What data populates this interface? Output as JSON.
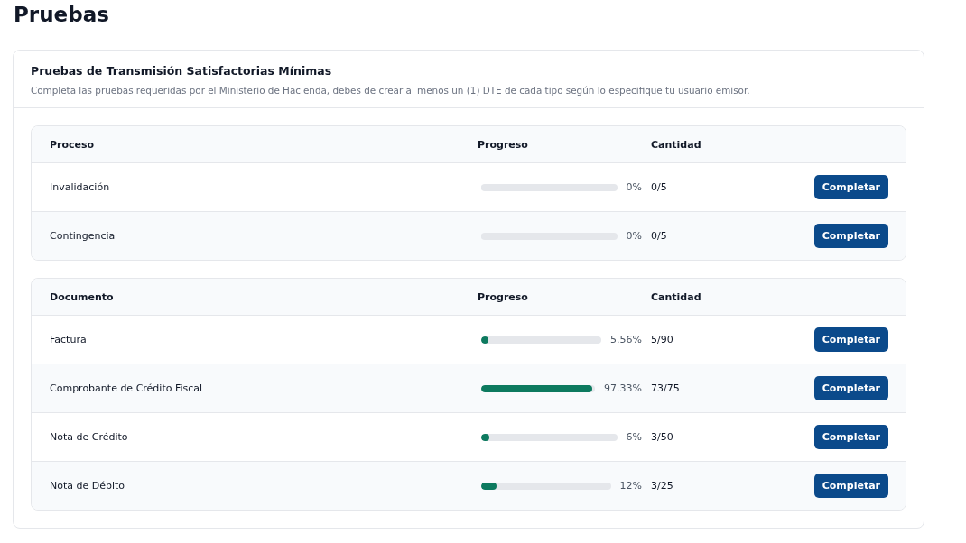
{
  "page_title": "Pruebas",
  "card": {
    "title": "Pruebas de Transmisión Satisfactorias Mínimas",
    "description": "Completa las pruebas requeridas por el Ministerio de Hacienda, debes de crear al menos un (1) DTE de cada tipo según lo especifique tu usuario emisor."
  },
  "tables": [
    {
      "columns": [
        "Proceso",
        "Progreso",
        "Cantidad"
      ],
      "rows": [
        {
          "name": "Invalidación",
          "level": 0,
          "percent": "0%",
          "quantity": "0/5",
          "button": "Completar"
        },
        {
          "name": "Contingencia",
          "level": 0,
          "percent": "0%",
          "quantity": "0/5",
          "button": "Completar"
        }
      ]
    },
    {
      "columns": [
        "Documento",
        "Progreso",
        "Cantidad"
      ],
      "rows": [
        {
          "name": "Factura",
          "level": 0.0556,
          "percent": "5.56%",
          "quantity": "5/90",
          "button": "Completar"
        },
        {
          "name": "Comprobante de Crédito Fiscal",
          "level": 0.9733,
          "percent": "97.33%",
          "quantity": "73/75",
          "button": "Completar"
        },
        {
          "name": "Nota de Crédito",
          "level": 0.06,
          "percent": "6%",
          "quantity": "3/50",
          "button": "Completar"
        },
        {
          "name": "Nota de Débito",
          "level": 0.12,
          "percent": "12%",
          "quantity": "3/25",
          "button": "Completar"
        }
      ]
    }
  ]
}
